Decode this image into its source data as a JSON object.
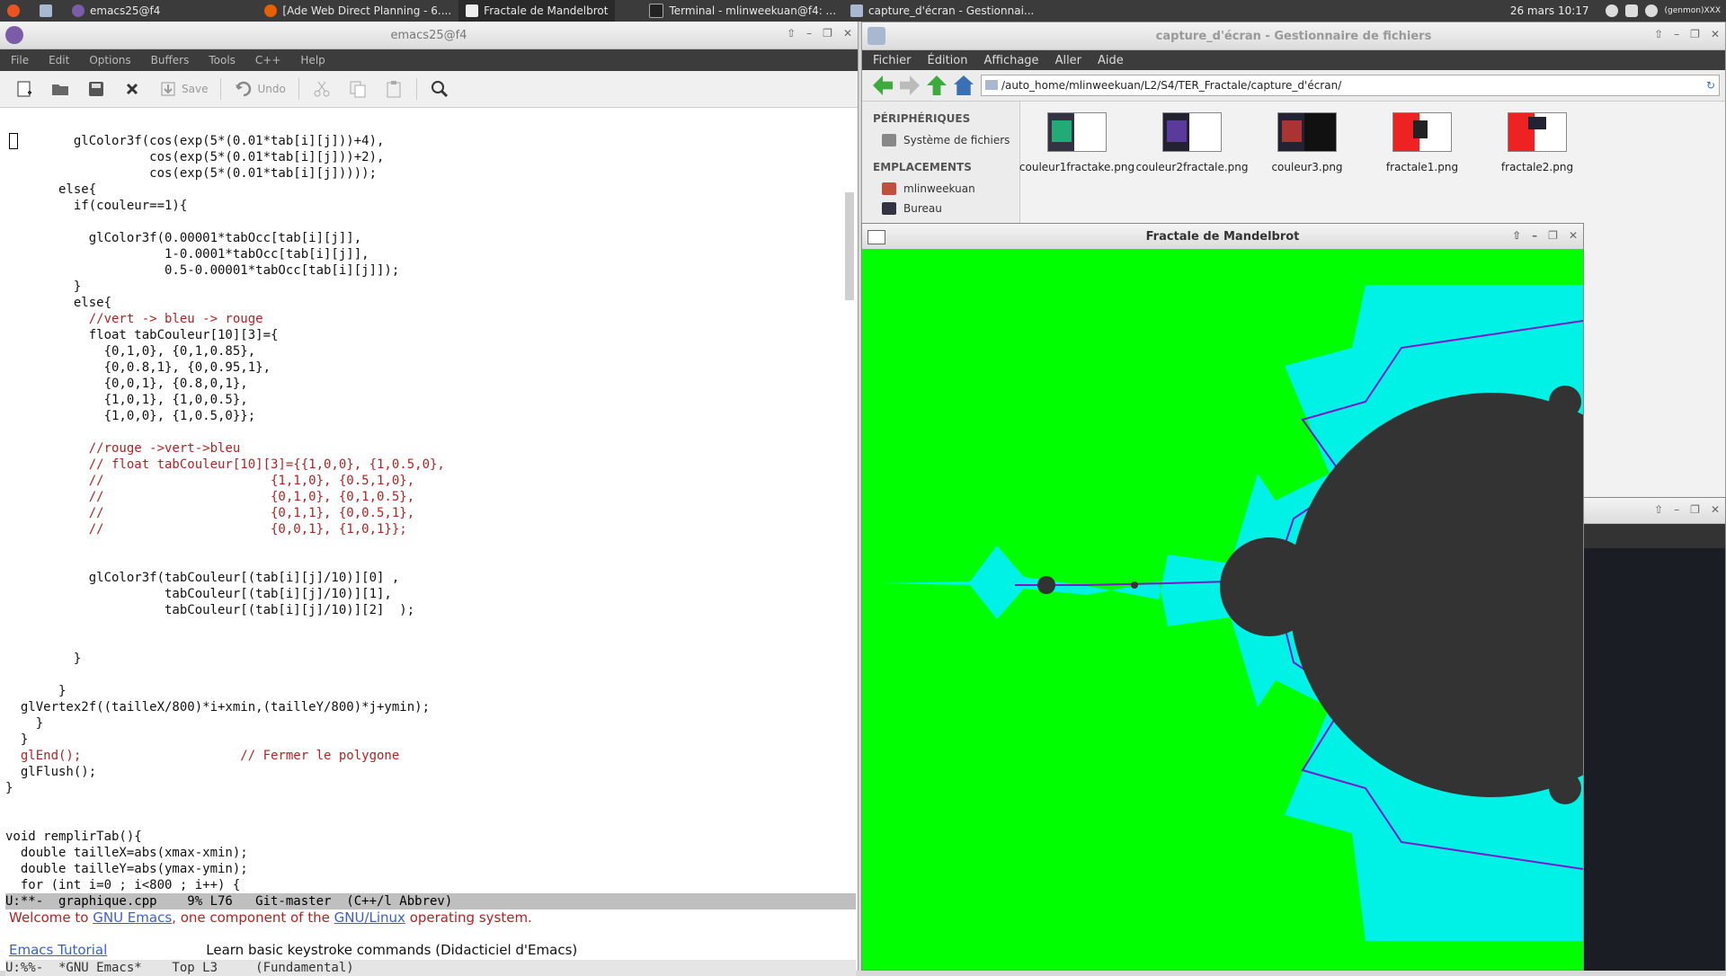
{
  "taskbar": {
    "items": [
      "emacs25@f4",
      "[Ade Web Direct Planning - 6....",
      "Fractale de Mandelbrot",
      "Terminal - mlinweekuan@f4: ...",
      "capture_d'écran - Gestionnai..."
    ],
    "datetime": "26 mars 10:17",
    "user": "(genmon)XXX"
  },
  "emacs": {
    "title": "emacs25@f4",
    "menu": [
      "File",
      "Edit",
      "Options",
      "Buffers",
      "Tools",
      "C++",
      "Help"
    ],
    "toolbar": {
      "save": "Save",
      "undo": "Undo"
    },
    "code": [
      "         glColor3f(cos(exp(5*(0.01*tab[i][j]))+4),",
      "                   cos(exp(5*(0.01*tab[i][j]))+2),",
      "                   cos(exp(5*(0.01*tab[i][j]))));",
      "       else{",
      "         if(couleur==1){",
      "",
      "           glColor3f(0.00001*tabOcc[tab[i][j]],",
      "                     1-0.0001*tabOcc[tab[i][j]],",
      "                     0.5-0.00001*tabOcc[tab[i][j]]);",
      "         }",
      "         else{",
      "           //vert -> bleu -> rouge",
      "           float tabCouleur[10][3]={",
      "             {0,1,0}, {0,1,0.85},",
      "             {0,0.8,1}, {0,0.95,1},",
      "             {0,0,1}, {0.8,0,1},",
      "             {1,0,1}, {1,0,0.5},",
      "             {1,0,0}, {1,0.5,0}};",
      "",
      "           //rouge ->vert->bleu",
      "           // float tabCouleur[10][3]={{1,0,0}, {1,0.5,0},",
      "           //                      {1,1,0}, {0.5,1,0},",
      "           //                      {0,1,0}, {0,1,0.5},",
      "           //                      {0,1,1}, {0,0.5,1},",
      "           //                      {0,0,1}, {1,0,1}};",
      "",
      "",
      "           glColor3f(tabCouleur[(tab[i][j]/10)][0] ,",
      "                     tabCouleur[(tab[i][j]/10)][1],",
      "                     tabCouleur[(tab[i][j]/10)][2]  );",
      "",
      "",
      "         }",
      "",
      "       }",
      "  glVertex2f((tailleX/800)*i+xmin,(tailleY/800)*j+ymin);",
      "    }",
      "  }",
      "  glEnd();                     // Fermer le polygone",
      "  glFlush();",
      "}",
      "",
      "",
      "void remplirTab(){",
      "  double tailleX=abs(xmax-xmin);",
      "  double tailleY=abs(ymax-ymin);",
      "  for (int i=0 ; i<800 ; i++) {"
    ],
    "modeline1": "U:**-  graphique.cpp    9% L76   Git-master  (C++/l Abbrev)",
    "echo": {
      "prefix": "Welcome to ",
      "gnu_emacs": "GNU Emacs",
      "middle": ", one component of the ",
      "gnu_linux": "GNU/Linux",
      "suffix": " operating system."
    },
    "tutorial_link": "Emacs Tutorial",
    "tutorial_desc": "Learn basic keystroke commands (Didacticiel d'Emacs)",
    "modeline2": "U:%%-  *GNU Emacs*    Top L3     (Fundamental)"
  },
  "file_manager": {
    "title": "capture_d'écran - Gestionnaire de fichiers",
    "menu": [
      "Fichier",
      "Édition",
      "Affichage",
      "Aller",
      "Aide"
    ],
    "path": "/auto_home/mlinweekuan/L2/S4/TER_Fractale/capture_d'écran/",
    "side": {
      "peripheriques_head": "PÉRIPHÉRIQUES",
      "systeme": "Système de fichiers",
      "emplacements_head": "EMPLACEMENTS",
      "home": "mlinweekuan",
      "bureau": "Bureau"
    },
    "files": [
      "couleur1fractake.png",
      "couleur2fractale.png",
      "couleur3.png",
      "fractale1.png",
      "fractale2.png"
    ]
  },
  "fractal_window": {
    "title": "Fractale de Mandelbrot",
    "colors": {
      "background": "#00ff00",
      "halo": "#00f2e6",
      "set": "#333333",
      "edge": "#7a1acc"
    }
  },
  "terminal": {
    "title": ""
  }
}
